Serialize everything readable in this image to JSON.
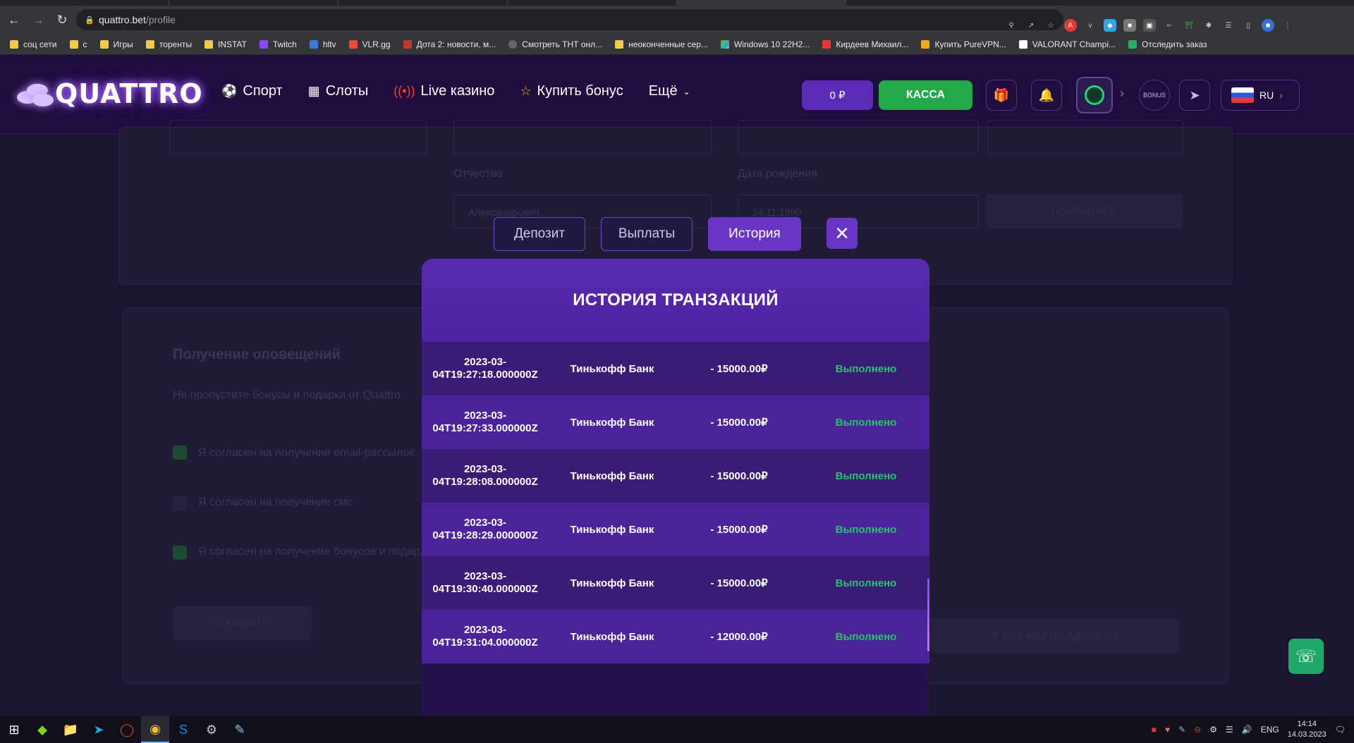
{
  "browser": {
    "url_host": "quattro.bet",
    "url_path": "/profile",
    "bookmarks": [
      "соц сети",
      "с",
      "Игры",
      "торенты",
      "INSTAT",
      "Twitch",
      "hltv",
      "VLR.gg",
      "Дота 2: новости, м...",
      "Смотреть ТНТ онл...",
      "неоконченные сер...",
      "Windows 10 22H2...",
      "Кирдеев Михаил...",
      "Купить PureVPN...",
      "VALORANT Champi...",
      "Отследить заказ"
    ]
  },
  "site": {
    "logo": "QUATTRO",
    "nav": [
      "Спорт",
      "Слоты",
      "Live казино",
      "Купить бонус",
      "Ещё"
    ],
    "balance": "0 ₽",
    "kassa": "КАССА",
    "lang": "RU"
  },
  "background_page": {
    "patronymic_label": "Отчество",
    "patronymic_value": "Александрович",
    "birth_label": "Дата рождения",
    "birth_value": "14.11.1990",
    "save": "СОХРАНИТЬ",
    "notif_title": "Получение оповещений",
    "notif_sub": "Не пропустите бонусы и подарки от Quattro",
    "check_email": "Я согласен на получение email-рассылок",
    "check_sms": "Я согласен на получение смс",
    "check_bonus": "Я согласен на получение бонусов и подар",
    "support": "В СЛУЖБУ ПОДДЕРЖКИ"
  },
  "modal": {
    "tabs": [
      "Депозит",
      "Выплаты",
      "История"
    ],
    "active_tab": "История",
    "title": "ИСТОРИЯ ТРАНЗАКЦИЙ",
    "rows": [
      {
        "date_line1": "2023-03-",
        "date_line2": "04T19:27:18.000000Z",
        "bank": "Тинькофф Банк",
        "amount": "- 15000.00₽",
        "status": "Выполнено"
      },
      {
        "date_line1": "2023-03-",
        "date_line2": "04T19:27:33.000000Z",
        "bank": "Тинькофф Банк",
        "amount": "- 15000.00₽",
        "status": "Выполнено"
      },
      {
        "date_line1": "2023-03-",
        "date_line2": "04T19:28:08.000000Z",
        "bank": "Тинькофф Банк",
        "amount": "- 15000.00₽",
        "status": "Выполнено"
      },
      {
        "date_line1": "2023-03-",
        "date_line2": "04T19:28:29.000000Z",
        "bank": "Тинькофф Банк",
        "amount": "- 15000.00₽",
        "status": "Выполнено"
      },
      {
        "date_line1": "2023-03-",
        "date_line2": "04T19:30:40.000000Z",
        "bank": "Тинькофф Банк",
        "amount": "- 15000.00₽",
        "status": "Выполнено"
      },
      {
        "date_line1": "2023-03-",
        "date_line2": "04T19:31:04.000000Z",
        "bank": "Тинькофф Банк",
        "amount": "- 12000.00₽",
        "status": "Выполнено"
      }
    ]
  },
  "taskbar": {
    "lang": "ENG",
    "time": "14:14",
    "date": "14.03.2023"
  }
}
